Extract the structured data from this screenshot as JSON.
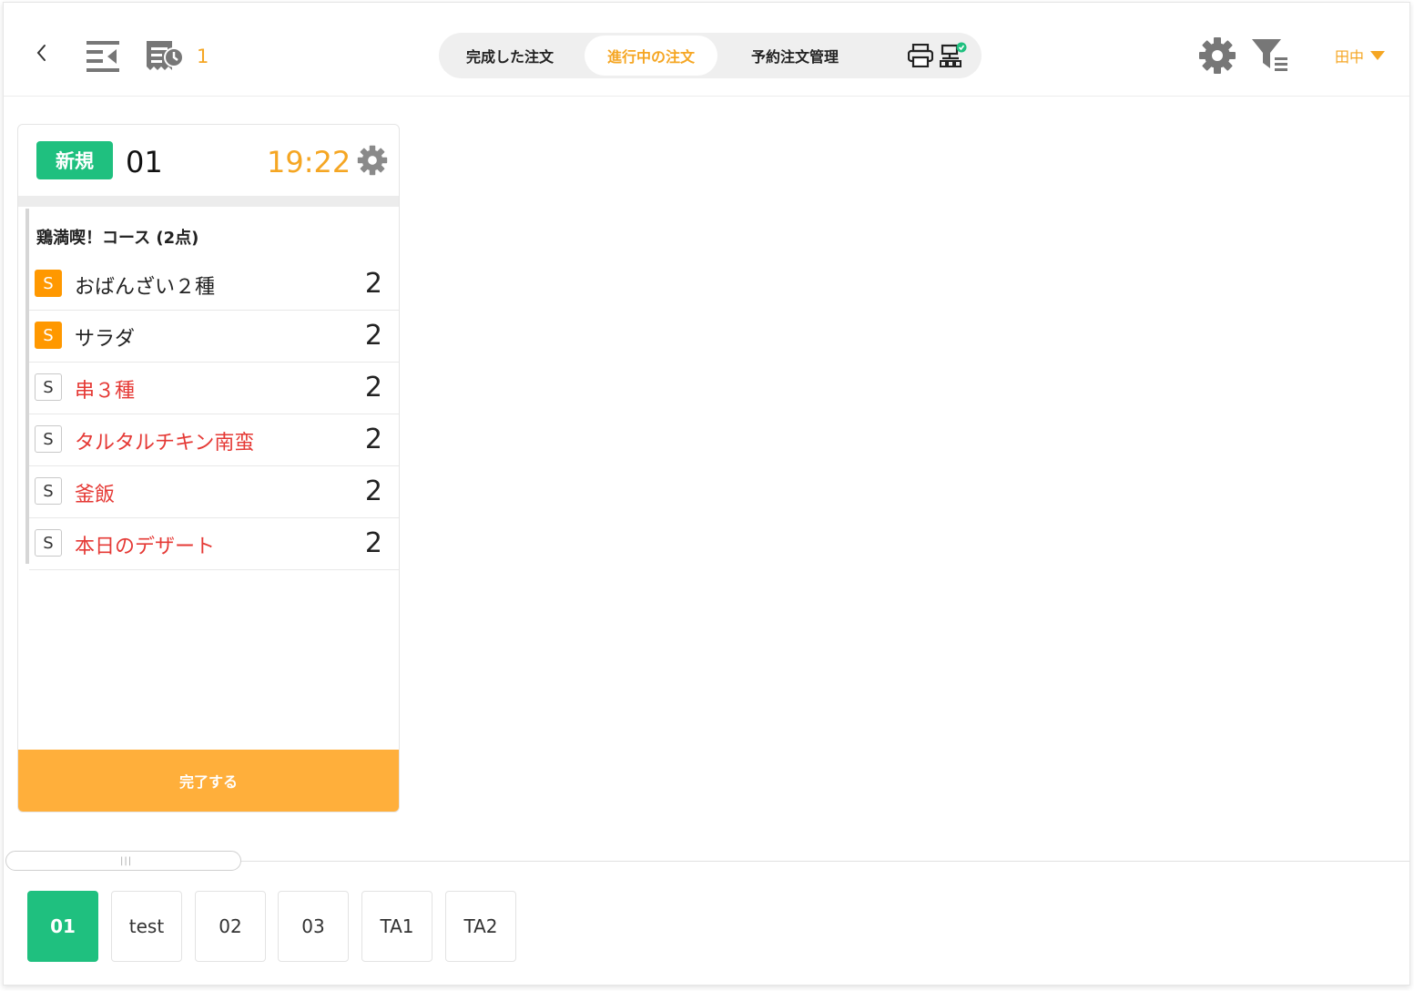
{
  "colors": {
    "accent": "#f5a623",
    "brand_green": "#1fc07f",
    "tag_orange": "#ff9800",
    "unserved_red": "#e53935",
    "complete_button": "#ffaf3b"
  },
  "header": {
    "back_icon": "chevron-left-icon",
    "left_icons": [
      "collapse-menu-icon",
      "receipt-clock-icon"
    ],
    "pending_count": "1",
    "tabs": [
      {
        "label": "完成した注文",
        "active": false
      },
      {
        "label": "進行中の注文",
        "active": true
      },
      {
        "label": "予約注文管理",
        "active": false
      }
    ],
    "tab_icons": [
      "printer-icon",
      "network-check-icon"
    ],
    "right_icons": [
      "gear-icon",
      "filter-list-icon"
    ],
    "user": "田中"
  },
  "order_card": {
    "status_badge": "新規",
    "table": "01",
    "time": "19:22",
    "course": "鶏満喫！コース (2点)",
    "items": [
      {
        "tag": "S",
        "name": "おばんざい２種",
        "qty": "2",
        "served": true
      },
      {
        "tag": "S",
        "name": "サラダ",
        "qty": "2",
        "served": true
      },
      {
        "tag": "S",
        "name": "串３種",
        "qty": "2",
        "served": false
      },
      {
        "tag": "S",
        "name": "タルタルチキン南蛮",
        "qty": "2",
        "served": false
      },
      {
        "tag": "S",
        "name": "釜飯",
        "qty": "2",
        "served": false
      },
      {
        "tag": "S",
        "name": "本日のデザート",
        "qty": "2",
        "served": false
      }
    ],
    "complete_label": "完了する"
  },
  "scrollbar_grip": "|||",
  "table_tabs": [
    {
      "label": "01",
      "active": true
    },
    {
      "label": "test",
      "active": false
    },
    {
      "label": "02",
      "active": false
    },
    {
      "label": "03",
      "active": false
    },
    {
      "label": "TA1",
      "active": false
    },
    {
      "label": "TA2",
      "active": false
    }
  ]
}
